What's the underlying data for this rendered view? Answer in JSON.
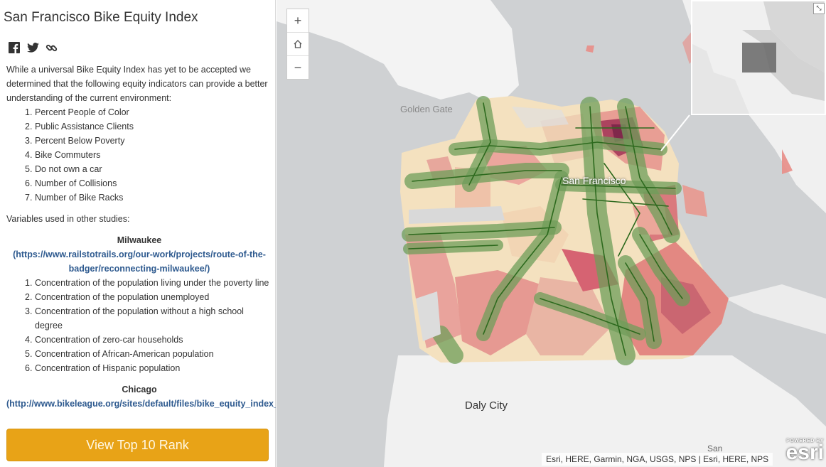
{
  "panel": {
    "title": "San Francisco Bike Equity Index",
    "social": [
      "facebook-icon",
      "twitter-icon",
      "link-icon"
    ],
    "intro": "While a universal Bike Equity Index has yet to be accepted we determined that the following equity indicators can provide a better understanding of the current environment:",
    "indicators": [
      {
        "num": "1.",
        "text": "Percent People of Color"
      },
      {
        "num": "2.",
        "text": "Public Assistance Clients"
      },
      {
        "num": "3.",
        "text": "Percent Below Poverty"
      },
      {
        "num": "4.",
        "text": "Bike Commuters"
      },
      {
        "num": "5.",
        "text": "Do not own a car"
      },
      {
        "num": "6.",
        "text": "Number of Collisions"
      },
      {
        "num": "7.",
        "text": "Number of Bike Racks"
      }
    ],
    "other_heading": "Variables used in other studies:",
    "milwaukee": {
      "name": "Milwaukee",
      "link": "(https://www.railstotrails.org/our-work/projects/route-of-the-badger/reconnecting-milwaukee/)",
      "items": [
        {
          "num": "1.",
          "text": "Concentration of the population living under the poverty line"
        },
        {
          "num": "2.",
          "text": "Concentration of the population unemployed"
        },
        {
          "num": "3.",
          "text": "Concentration of the population without a high school degree"
        },
        {
          "num": "4.",
          "text": "Concentration of zero-car households"
        },
        {
          "num": "5.",
          "text": "Concentration of African-American population"
        },
        {
          "num": "6.",
          "text": "Concentration of Hispanic population"
        }
      ]
    },
    "chicago": {
      "name": "Chicago",
      "link": "(http://www.bikeleague.org/sites/default/files/bike_equity_index_final_web.pdf)"
    },
    "cta_label": "View Top 10 Rank"
  },
  "map": {
    "zoom_in": "+",
    "zoom_out": "−",
    "home_icon": "home-icon",
    "labels": {
      "golden_gate": "Golden Gate",
      "san_francisco": "San Francisco",
      "daly_city": "Daly City",
      "san": "San"
    },
    "attribution": "Esri, HERE, Garmin, NGA, USGS, NPS | Esri, HERE, NPS",
    "esri_powered": "POWERED BY",
    "esri_logo": "esri",
    "colors": {
      "water": "#cfd1d3",
      "land": "#f3f3f3",
      "low": "#f6dcb4",
      "mid": "#e79a92",
      "high": "#a83a5a",
      "buffer": "#7aa866",
      "route": "#2d6a1e"
    }
  }
}
